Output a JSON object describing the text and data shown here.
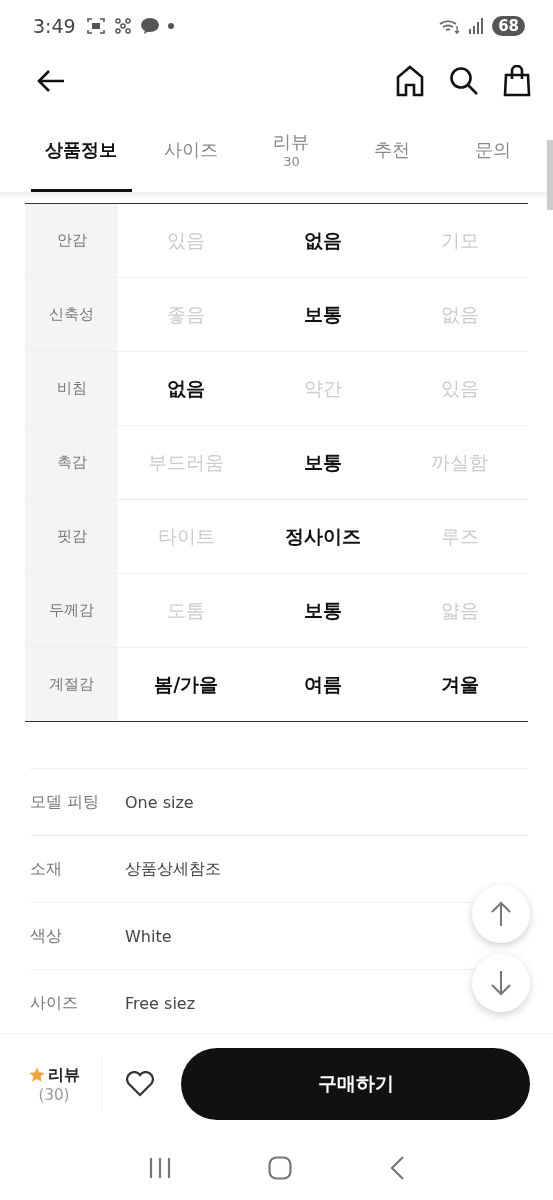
{
  "status_bar": {
    "time": "3:49",
    "battery": "68"
  },
  "tabs": [
    {
      "label": "상품정보",
      "selected": true
    },
    {
      "label": "사이즈",
      "selected": false
    },
    {
      "label": "리뷰",
      "count": "30",
      "selected": false
    },
    {
      "label": "추천",
      "selected": false
    },
    {
      "label": "문의",
      "selected": false
    }
  ],
  "attributes": [
    {
      "name": "안감",
      "options": [
        {
          "label": "있음",
          "selected": false
        },
        {
          "label": "없음",
          "selected": true
        },
        {
          "label": "기모",
          "selected": false
        }
      ]
    },
    {
      "name": "신축성",
      "options": [
        {
          "label": "좋음",
          "selected": false
        },
        {
          "label": "보통",
          "selected": true
        },
        {
          "label": "없음",
          "selected": false
        }
      ]
    },
    {
      "name": "비침",
      "options": [
        {
          "label": "없음",
          "selected": true
        },
        {
          "label": "약간",
          "selected": false
        },
        {
          "label": "있음",
          "selected": false
        }
      ]
    },
    {
      "name": "촉감",
      "options": [
        {
          "label": "부드러움",
          "selected": false
        },
        {
          "label": "보통",
          "selected": true
        },
        {
          "label": "까실함",
          "selected": false
        }
      ]
    },
    {
      "name": "핏감",
      "options": [
        {
          "label": "타이트",
          "selected": false
        },
        {
          "label": "정사이즈",
          "selected": true
        },
        {
          "label": "루즈",
          "selected": false
        }
      ]
    },
    {
      "name": "두께감",
      "options": [
        {
          "label": "도톰",
          "selected": false
        },
        {
          "label": "보통",
          "selected": true
        },
        {
          "label": "얇음",
          "selected": false
        }
      ]
    },
    {
      "name": "계절감",
      "options": [
        {
          "label": "봄/가을",
          "selected": true
        },
        {
          "label": "여름",
          "selected": true
        },
        {
          "label": "겨울",
          "selected": true
        }
      ]
    }
  ],
  "details": [
    {
      "label": "모델 피팅",
      "value": "One size"
    },
    {
      "label": "소재",
      "value": "상품상세참조"
    },
    {
      "label": "색상",
      "value": "White"
    },
    {
      "label": "사이즈",
      "value": "Free siez"
    }
  ],
  "bottom_bar": {
    "review_label": "리뷰",
    "review_count": "(30)",
    "buy_button": "구매하기"
  }
}
